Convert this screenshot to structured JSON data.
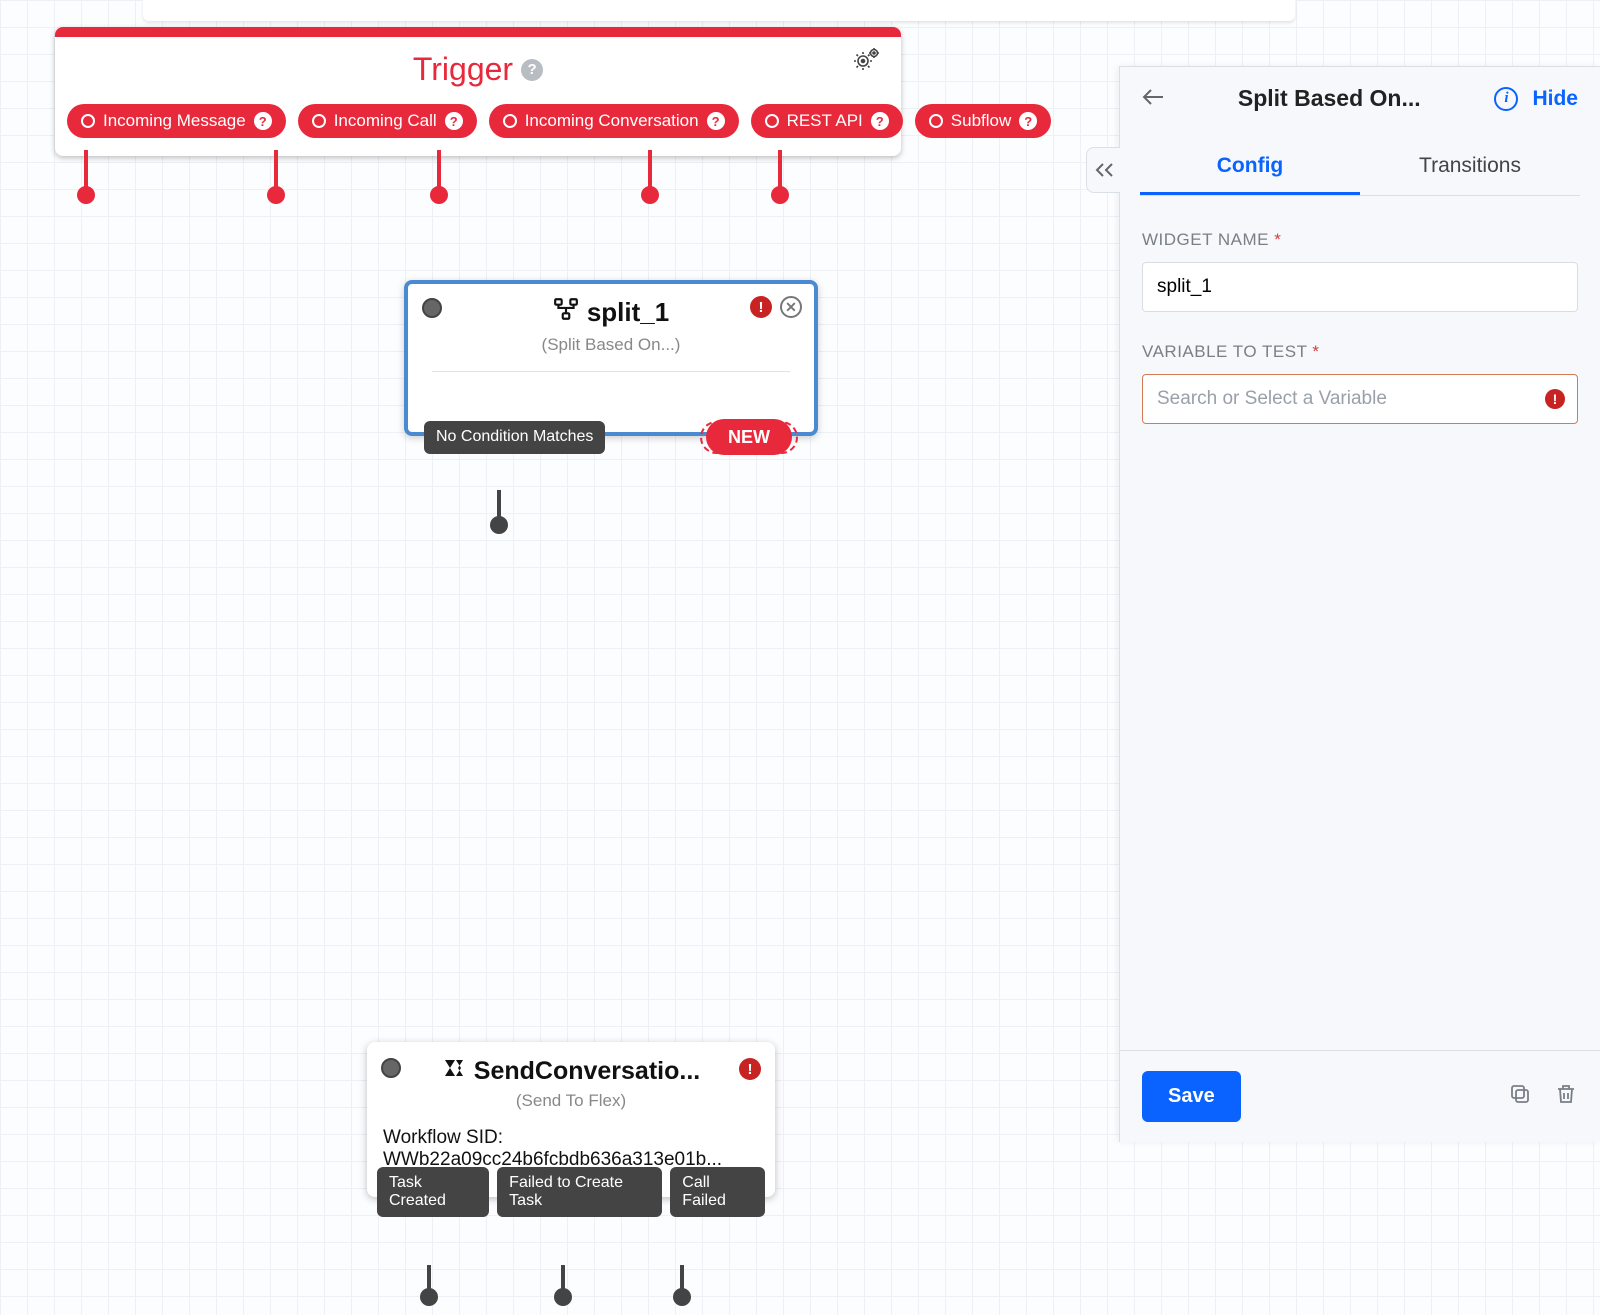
{
  "trigger": {
    "title": "Trigger",
    "events": [
      {
        "label": "Incoming Message"
      },
      {
        "label": "Incoming Call"
      },
      {
        "label": "Incoming Conversation"
      },
      {
        "label": "REST API"
      },
      {
        "label": "Subflow"
      }
    ]
  },
  "split": {
    "title": "split_1",
    "subtitle": "(Split Based On...)",
    "no_match_label": "No Condition Matches",
    "new_label": "NEW"
  },
  "send_conversation": {
    "title": "SendConversatio...",
    "subtitle": "(Send To Flex)",
    "body_label": "Workflow SID:",
    "body_value": "WWb22a09cc24b6fcbdb636a313e01b...",
    "outputs": [
      {
        "label": "Task Created"
      },
      {
        "label": "Failed to Create Task"
      },
      {
        "label": "Call Failed"
      }
    ]
  },
  "panel": {
    "title": "Split Based On...",
    "hide_label": "Hide",
    "tabs": {
      "config": "Config",
      "transitions": "Transitions"
    },
    "form": {
      "widget_name_label": "WIDGET NAME",
      "widget_name_value": "split_1",
      "variable_label": "VARIABLE TO TEST",
      "variable_placeholder": "Search or Select a Variable"
    },
    "save_label": "Save"
  }
}
